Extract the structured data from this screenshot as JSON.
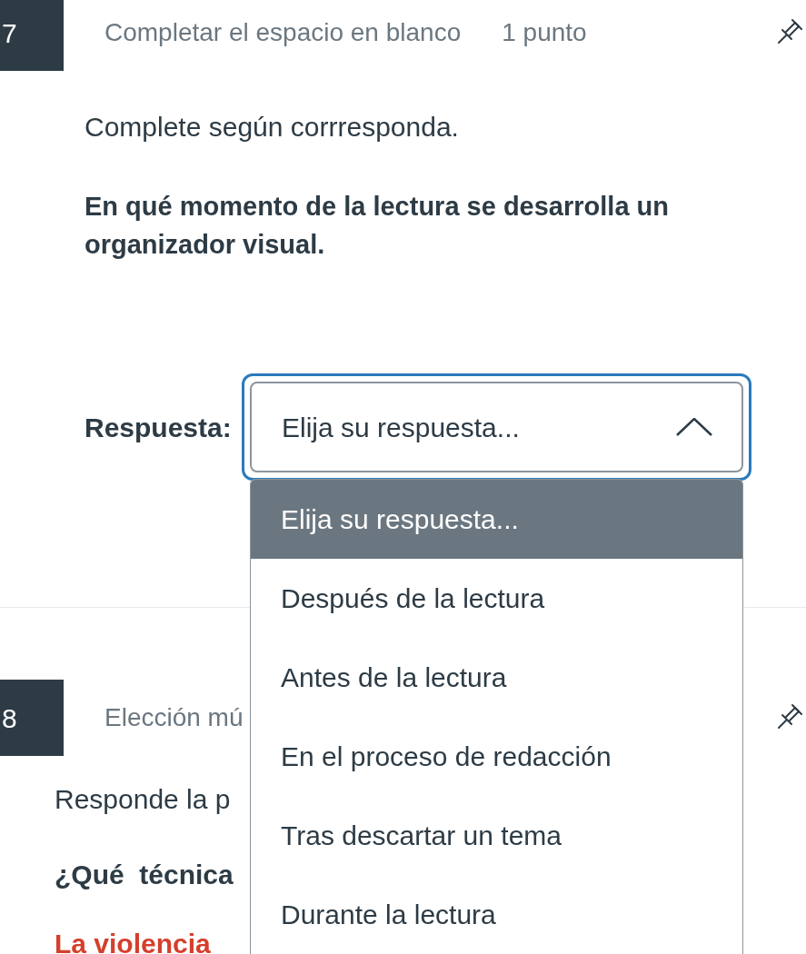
{
  "questions": [
    {
      "number": "7",
      "type_label": "Completar el espacio en blanco",
      "points": "1 punto",
      "instruction": "Complete según corrresponda.",
      "prompt": "En qué momento de la lectura se desarrolla un organizador visual.",
      "answer": {
        "label": "Respuesta:",
        "value": "Elija su respuesta...",
        "focused": true,
        "expanded": true,
        "options": [
          {
            "label": "Elija su respuesta...",
            "selected": true
          },
          {
            "label": "Después de la lectura",
            "selected": false
          },
          {
            "label": "Antes de la lectura",
            "selected": false
          },
          {
            "label": "En el proceso de redacción",
            "selected": false
          },
          {
            "label": "Tras descartar un tema",
            "selected": false
          },
          {
            "label": "Durante la lectura",
            "selected": false
          }
        ]
      }
    },
    {
      "number": "8",
      "type_label": "Elección mú",
      "instruction": "Responde la p",
      "prompt": "¿Qué  técnica",
      "excerpt": "La violencia"
    }
  ]
}
